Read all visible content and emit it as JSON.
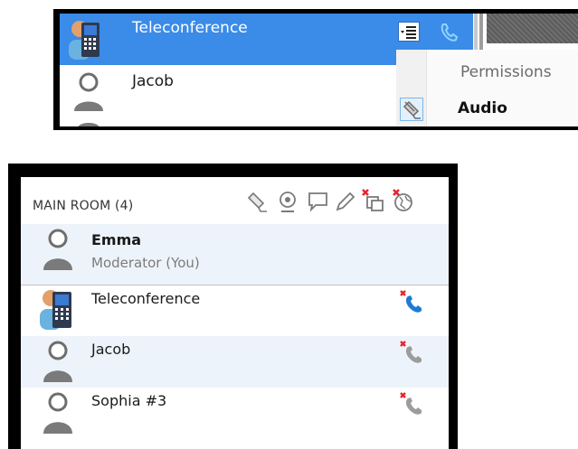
{
  "top": {
    "selected_row": {
      "name": "Teleconference"
    },
    "row2": {
      "name": "Jacob"
    },
    "context_menu": {
      "items": [
        "Permissions",
        "Audio"
      ]
    }
  },
  "room": {
    "header": "MAIN ROOM (4)",
    "participants": [
      {
        "name": "Emma",
        "role": "Moderator (You)",
        "avatar": "person-icon"
      },
      {
        "name": "Teleconference",
        "avatar": "teleconference-icon",
        "audio": "phone-muted-blue-icon"
      },
      {
        "name": "Jacob",
        "avatar": "person-icon",
        "audio": "phone-muted-grey-icon"
      },
      {
        "name": "Sophia #3",
        "avatar": "person-icon",
        "audio": "phone-muted-grey-icon"
      }
    ],
    "header_icons": [
      "mic-permission-icon",
      "webcam-icon",
      "chat-icon",
      "pencil-icon",
      "share-muted-icon",
      "globe-muted-icon"
    ]
  },
  "colors": {
    "selection_blue": "#3b8be8",
    "row_alt": "#edf3fa",
    "mute_red": "#e8232b",
    "phone_blue": "#1f7ad6"
  }
}
